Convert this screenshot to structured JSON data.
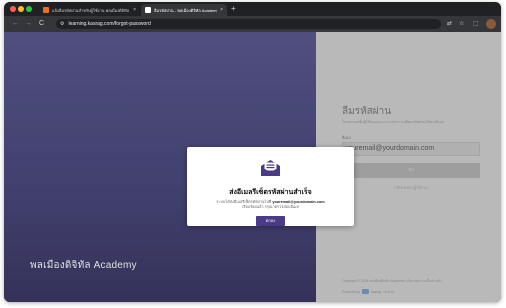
{
  "browser": {
    "tabs": [
      {
        "title": "แจ้งลืมรหัสผ่านสำหรับผู้ใช้งาน พลเมืองดิจิทัล Academy",
        "close": "×"
      },
      {
        "title": "ลืมรหัสผ่าน - พลเมืองดิจิทัล Academy",
        "close": "×"
      }
    ],
    "new_tab": "+",
    "back": "←",
    "forward": "→",
    "reload": "C",
    "url": "learning.kasrag.com/forgot-password"
  },
  "page": {
    "brand": "พลเมืองดิจิทัล Academy",
    "form": {
      "title": "ลืมรหัสผ่าน",
      "description": "โปรดกรอกชื่อผู้ใช้ของคุณ เราจะส่งการเปลี่ยนรหัสผ่านให้ทางอีเมล",
      "email_label": "อีเมล",
      "email_value": "youremail@yourdomain.com",
      "submit_label": "ส่ง",
      "back_link": "กลับไปหน้าผู้ใช้งาน"
    },
    "footer": {
      "copyright": "Copyright © 2024 พลเมืองดิจิทัล Academy นโยบายความเป็นส่วนตัว",
      "powered_by": "Powered by",
      "powered_vendor": "kasrag",
      "version": "v4.6.23"
    }
  },
  "modal": {
    "title": "ส่งอีเมลรีเซ็ตรหัสผ่านสำเร็จ",
    "body_prefix": "ระบบได้ส่งอีเมลรีเซ็ตรหัสผ่านไปที่",
    "body_email": "youremail@yourdomain.com",
    "body_suffix": "เรียบร้อยแล้ว กรุณาตรวจสอบอีเมล",
    "ok_label": "ตกลง"
  },
  "colors": {
    "left_panel": "#5b5a91",
    "modal_button": "#4b3a86"
  }
}
